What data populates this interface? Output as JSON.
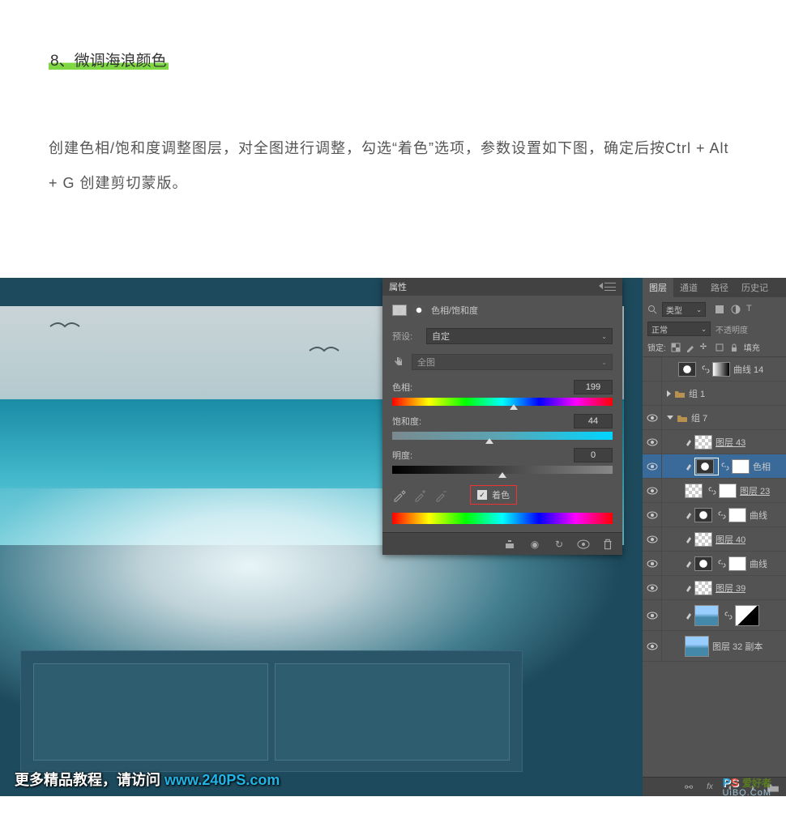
{
  "article": {
    "section_title": "8、微调海浪颜色",
    "body": "创建色相/饱和度调整图层，对全图进行调整，勾选“着色”选项，参数设置如下图，确定后按Ctrl + Alt + G 创建剪切蒙版。"
  },
  "properties_panel": {
    "title": "属性",
    "adj_name": "色相/饱和度",
    "preset_label": "预设:",
    "preset_value": "自定",
    "range_label": "全图",
    "hue_label": "色相:",
    "hue_value": "199",
    "sat_label": "饱和度:",
    "sat_value": "44",
    "light_label": "明度:",
    "light_value": "0",
    "colorize_label": "着色"
  },
  "layers_panel": {
    "tabs": [
      "图层",
      "通道",
      "路径",
      "历史记"
    ],
    "kind_label": "类型",
    "blend_mode": "正常",
    "opacity_label": "不透明度",
    "lock_label": "锁定:",
    "fill_label": "填充",
    "items": [
      {
        "name": "曲线 14",
        "type": "adj-curves"
      },
      {
        "name": "组 1",
        "type": "group-closed"
      },
      {
        "name": "组 7",
        "type": "group-open"
      },
      {
        "name": "图层 43",
        "type": "raster"
      },
      {
        "name": "色相",
        "type": "adj-hue",
        "selected": true
      },
      {
        "name": "图层 23",
        "type": "raster-mask"
      },
      {
        "name": "曲线",
        "type": "adj-curves-mask"
      },
      {
        "name": "图层 40",
        "type": "raster"
      },
      {
        "name": "曲线",
        "type": "adj-curves-mask"
      },
      {
        "name": "图层 39",
        "type": "raster"
      },
      {
        "name": "",
        "type": "smart-mask"
      },
      {
        "name": "图层 32 副本",
        "type": "smart"
      }
    ]
  },
  "watermark": {
    "text_pre": "更多精品教程，请访问 ",
    "url": "www.240PS.com",
    "logo_p": "P",
    "logo_s": "S",
    "logo_cn": "爱好者",
    "logo_domain": "UiBQ.CoM"
  }
}
